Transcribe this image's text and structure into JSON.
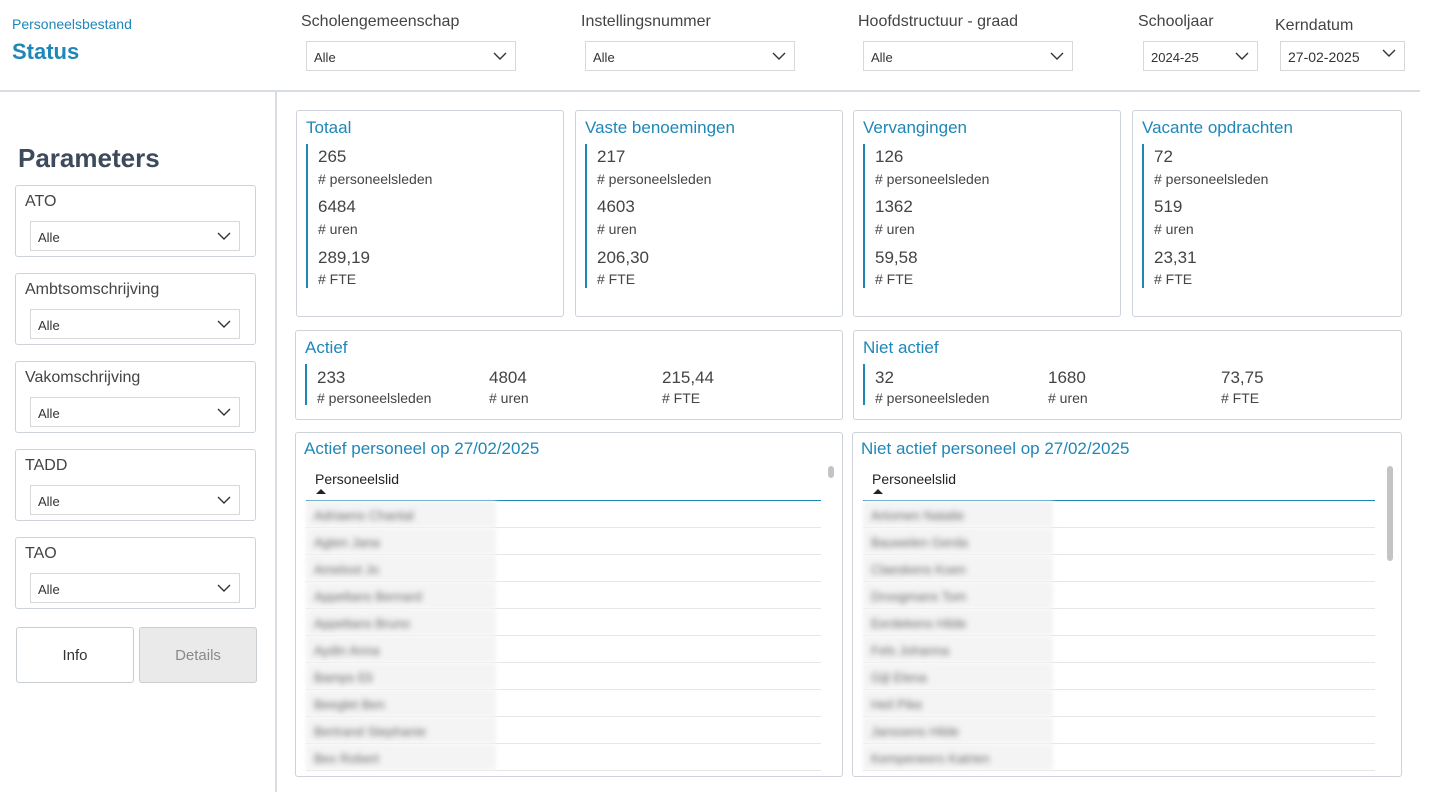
{
  "header": {
    "breadcrumb": "Personeelsbestand",
    "title": "Status",
    "filters": [
      {
        "label": "Scholengemeenschap",
        "value": "Alle"
      },
      {
        "label": "Instellingsnummer",
        "value": "Alle"
      },
      {
        "label": "Hoofdstructuur - graad",
        "value": "Alle"
      },
      {
        "label": "Schooljaar",
        "value": "2024-25"
      },
      {
        "label": "Kerndatum",
        "value": "27-02-2025"
      }
    ]
  },
  "sidebar": {
    "title": "Parameters",
    "params": [
      {
        "label": "ATO",
        "value": "Alle"
      },
      {
        "label": "Ambtsomschrijving",
        "value": "Alle"
      },
      {
        "label": "Vakomschrijving",
        "value": "Alle"
      },
      {
        "label": "TADD",
        "value": "Alle"
      },
      {
        "label": "TAO",
        "value": "Alle"
      }
    ],
    "info_label": "Info",
    "details_label": "Details"
  },
  "labels": {
    "personeelsleden": "# personeelsleden",
    "uren": "# uren",
    "fte": "# FTE"
  },
  "kpis": [
    {
      "title": "Totaal",
      "personeelsleden": "265",
      "uren": "6484",
      "fte": "289,19"
    },
    {
      "title": "Vaste benoemingen",
      "personeelsleden": "217",
      "uren": "4603",
      "fte": "206,30"
    },
    {
      "title": "Vervangingen",
      "personeelsleden": "126",
      "uren": "1362",
      "fte": "59,58"
    },
    {
      "title": "Vacante opdrachten",
      "personeelsleden": "72",
      "uren": "519",
      "fte": "23,31"
    }
  ],
  "status": [
    {
      "title": "Actief",
      "personeelsleden": "233",
      "uren": "4804",
      "fte": "215,44"
    },
    {
      "title": "Niet actief",
      "personeelsleden": "32",
      "uren": "1680",
      "fte": "73,75"
    }
  ],
  "tables": [
    {
      "title": "Actief personeel op 27/02/2025",
      "column": "Personeelslid",
      "rows": [
        "Adriaens Chantal",
        "Agten Jana",
        "Ameloot Jo",
        "Appeltans Bernard",
        "Appeltans Bruno",
        "Aydin Anna",
        "Bamps Eli",
        "Beeglet Ben",
        "Bertrand Stephanie",
        "Bex Robert"
      ]
    },
    {
      "title": "Niet actief personeel op 27/02/2025",
      "column": "Personeelslid",
      "rows": [
        "Artomen Natalie",
        "Bauwelen Gerda",
        "Claeskens Koen",
        "Droogmans Tom",
        "Eerdekens Hilde",
        "Fels Johanna",
        "Gijl Elena",
        "Heil Pike",
        "Janssens Hilde",
        "Kempeneers Katrien"
      ]
    }
  ]
}
